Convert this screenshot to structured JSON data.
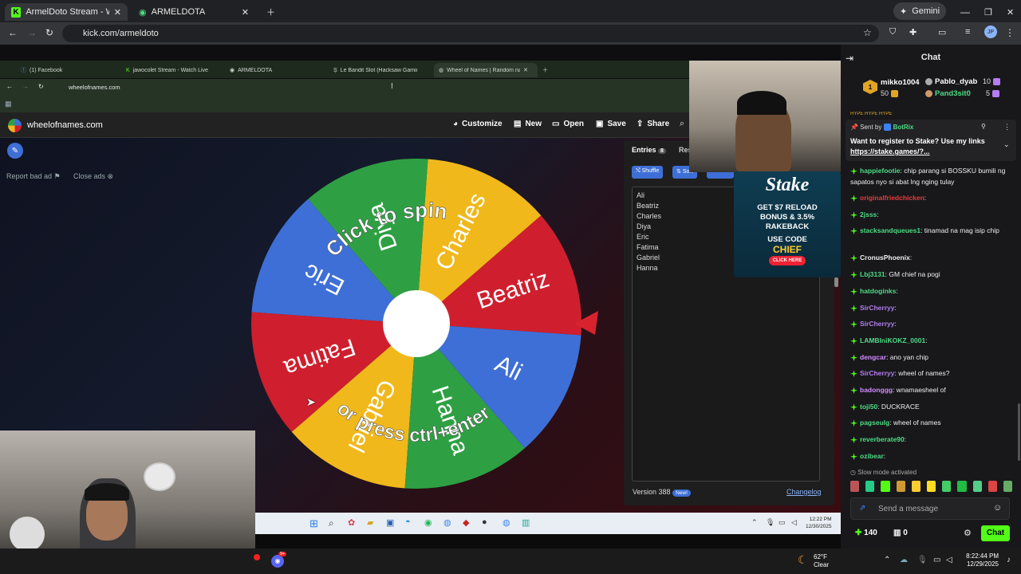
{
  "browser": {
    "tabs": [
      {
        "title": "ArmelDoto Stream - Watch Live"
      },
      {
        "title": "ARMELDOTA"
      }
    ],
    "gemini_label": "Gemini",
    "url": "kick.com/armeldoto"
  },
  "inner_browser": {
    "tabs": [
      {
        "title": "(1) Facebook"
      },
      {
        "title": "jawocolet Stream - Watch Live"
      },
      {
        "title": "ARMELDOTA"
      },
      {
        "title": "Le Bandit Slot (Hacksaw Gaming)"
      },
      {
        "title": "Wheel of Names | Random nam"
      }
    ],
    "url": "wheelofnames.com"
  },
  "won": {
    "logo": "wheelofnames.com",
    "toolbar": {
      "customize": "Customize",
      "new": "New",
      "open": "Open",
      "save": "Save",
      "share": "Share"
    },
    "report_label": "Report bad ad",
    "close_ads_label": "Close ads",
    "wheel_top_text": "Click to spin",
    "wheel_bottom_text": "or press ctrl+enter",
    "segments": [
      {
        "name": "Ali",
        "color": "#3e6fd6"
      },
      {
        "name": "Beatriz",
        "color": "#cf1f2e"
      },
      {
        "name": "Charles",
        "color": "#f0b81b"
      },
      {
        "name": "Diya",
        "color": "#2ea043"
      },
      {
        "name": "Eric",
        "color": "#3e6fd6"
      },
      {
        "name": "Fatima",
        "color": "#cf1f2e"
      },
      {
        "name": "Gabriel",
        "color": "#f0b81b"
      },
      {
        "name": "Hanna",
        "color": "#2ea043"
      }
    ],
    "entries_tab": "Entries",
    "entries_count": "8",
    "results_tab": "Res",
    "shuffle": "Shuffle",
    "sort": "Sort",
    "add_image": "Add im",
    "entries": [
      "Ali",
      "Beatriz",
      "Charles",
      "Diya",
      "Eric",
      "Fatima",
      "Gabriel",
      "Hanna"
    ],
    "version": "Version 388",
    "new_badge": "New!",
    "changelog": "Changelog",
    "inner_clock": {
      "time": "12:22 PM",
      "date": "12/30/2025"
    }
  },
  "ad": {
    "brand": "Stake",
    "line1": "GET $7 RELOAD",
    "line2": "BONUS & 3.5%",
    "line3": "RAKEBACK",
    "line4": "USE CODE",
    "code": "CHIEF",
    "cta": "CLICK HERE"
  },
  "chat": {
    "title": "Chat",
    "leaders": [
      {
        "name": "mikko1004",
        "points": "50"
      },
      {
        "name": "Pablo_dyab",
        "points": "10"
      },
      {
        "name": "Pand3sit0",
        "points": "5"
      }
    ],
    "hype": "HYPE HYPE HYPE",
    "pinned": {
      "sent_by": "Sent by",
      "bot": "BotRix",
      "text": "Want to register to Stake? Use my links",
      "link": "https://stake.games/?..."
    },
    "messages": [
      {
        "user": "happiefootie",
        "color": "#4ddc84",
        "text": ": chip parang si BOSSKU bumili ng sapatos nyo si abat lng nging tulay"
      },
      {
        "user": "originalfriedchicken",
        "color": "#e93b3b",
        "text": ":"
      },
      {
        "user": "2jsss",
        "color": "#4ddc84",
        "text": ":"
      },
      {
        "user": "stacksandqueues1",
        "color": "#4ddc84",
        "text": ": tinamad na mag isip chip"
      },
      {
        "user": "CronusPhoenix",
        "color": "#efeff1",
        "text": ":"
      },
      {
        "user": "Lbj3131",
        "color": "#4ddc84",
        "text": ": GM chief na pogi"
      },
      {
        "user": "hatdoginks",
        "color": "#4ddc84",
        "text": ":"
      },
      {
        "user": "SirCherryy",
        "color": "#b67cf1",
        "text": ":"
      },
      {
        "user": "SirCherryy",
        "color": "#b67cf1",
        "text": ":"
      },
      {
        "user": "LAMBIniKOKZ_0001",
        "color": "#4ddc84",
        "text": ":"
      },
      {
        "user": "dengcar",
        "color": "#d48bff",
        "text": ": ano yan chip"
      },
      {
        "user": "SirCherryy",
        "color": "#b67cf1",
        "text": ": wheel of names?"
      },
      {
        "user": "badonggg",
        "color": "#d48bff",
        "text": ": wnamaesheel of"
      },
      {
        "user": "toji50",
        "color": "#4ddc84",
        "text": ": DUCKRACE"
      },
      {
        "user": "pagseulg",
        "color": "#4ddc84",
        "text": ": wheel of names"
      },
      {
        "user": "reverberate90",
        "color": "#4ddc84",
        "text": ":"
      },
      {
        "user": "ozibear",
        "color": "#4ddc84",
        "text": ":"
      }
    ],
    "slow_mode": "Slow mode activated",
    "input_placeholder": "Send a message",
    "points": "140",
    "gift_count": "0",
    "send_label": "Chat"
  },
  "taskbar": {
    "weather_temp": "62°F",
    "weather_text": "Clear",
    "time": "8:22:44 PM",
    "date": "12/29/2025",
    "notif": "9+"
  }
}
